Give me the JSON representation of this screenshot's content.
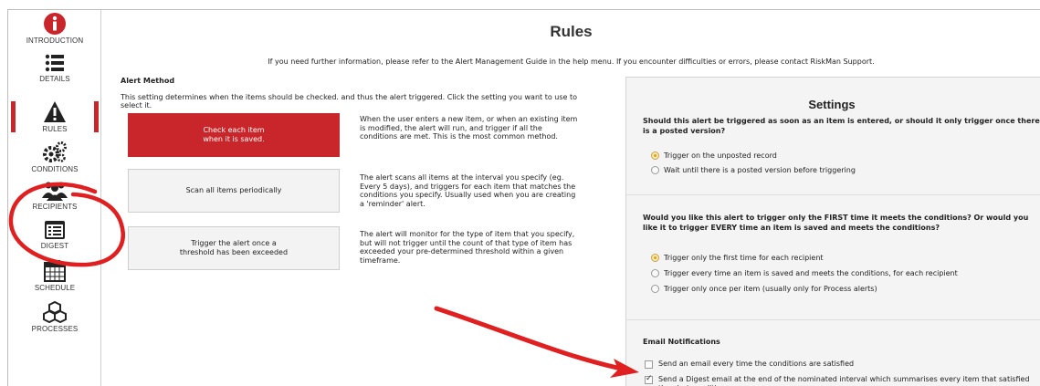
{
  "sidebar": {
    "items": [
      {
        "label": "INTRODUCTION",
        "icon": "info-icon"
      },
      {
        "label": "DETAILS",
        "icon": "list-icon"
      },
      {
        "label": "RULES",
        "icon": "warning-icon"
      },
      {
        "label": "CONDITIONS",
        "icon": "gears-icon"
      },
      {
        "label": "RECIPIENTS",
        "icon": "people-icon"
      },
      {
        "label": "DIGEST",
        "icon": "digest-icon"
      },
      {
        "label": "SCHEDULE",
        "icon": "calendar-icon"
      },
      {
        "label": "PROCESSES",
        "icon": "cubes-icon"
      }
    ],
    "active": "RULES",
    "accent": "#c8262a"
  },
  "page": {
    "title": "Rules",
    "help": "If you need further information, please refer to the Alert Management Guide in the help menu. If you encounter difficulties or errors, please contact RiskMan Support."
  },
  "alert_method": {
    "title": "Alert Method",
    "description": "This setting determines when the items should be checked. and thus the alert triggered. Click the setting you want to use to select it.",
    "options": [
      {
        "label": "Check each item\nwhen it is saved.",
        "description": "When the user enters a new item, or when an existing item is modified, the alert will run, and trigger if all the conditions are met. This is the most common method.",
        "selected": true
      },
      {
        "label": "Scan all items periodically",
        "description": "The alert scans all items at the interval you specify (eg. Every 5 days), and triggers for each item that matches the conditions you specify. Usually used when you are creating a 'reminder' alert.",
        "selected": false
      },
      {
        "label": "Trigger the alert once a\nthreshold has been exceeded",
        "description": "The alert will monitor for the type of item that you specify, but will not trigger until the count of that type of item has exceeded your pre-determined threshold within a given timeframe.",
        "selected": false
      }
    ]
  },
  "settings": {
    "title": "Settings",
    "q1": "Should this alert be triggered as soon as an item is entered, or should it only trigger once there is a posted version?",
    "q1_options": [
      {
        "label": "Trigger on the unposted record",
        "selected": true
      },
      {
        "label": "Wait until there is a posted version before triggering",
        "selected": false
      }
    ],
    "q2": "Would you like this alert to trigger only the FIRST time it meets the conditions? Or would you like it to trigger EVERY time an item is saved and meets the conditions?",
    "q2_options": [
      {
        "label": "Trigger only the first time for each recipient",
        "selected": true
      },
      {
        "label": "Trigger every time an item is saved and meets the conditions, for each recipient",
        "selected": false
      },
      {
        "label": "Trigger only once per item (usually only for Process alerts)",
        "selected": false
      }
    ],
    "email_title": "Email Notifications",
    "email_options": [
      {
        "label": "Send an email every time the conditions are satisfied",
        "checked": false
      },
      {
        "label": "Send a Digest email at the end of the nominated interval which summarises every item that satisfied the alert conditions.",
        "checked": true
      }
    ]
  },
  "annotation": {
    "color": "#e02020"
  }
}
